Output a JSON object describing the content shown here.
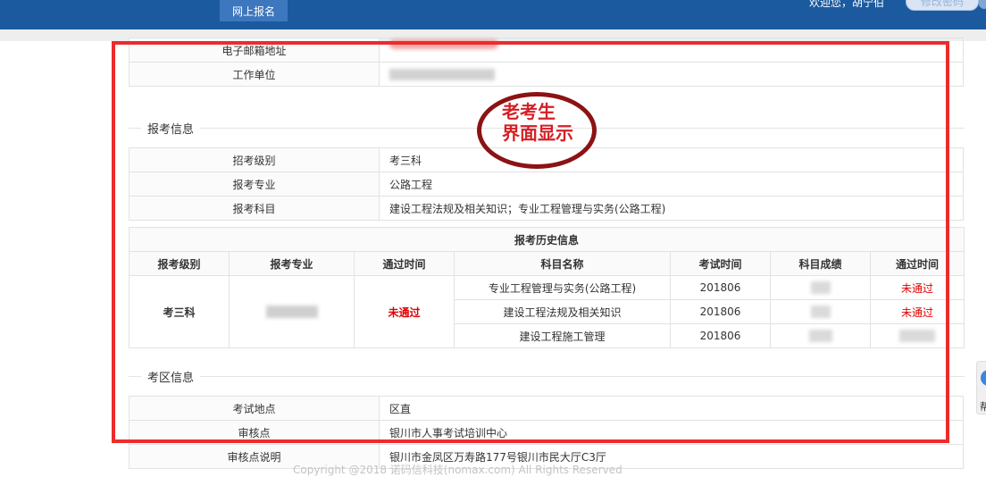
{
  "header": {
    "nav_tab": "网上报名",
    "welcome": "欢迎您，胡宁伯",
    "modify_button": "修改密码"
  },
  "personal_info": {
    "email_label": "电子邮箱地址",
    "workplace_label": "工作单位"
  },
  "exam_info": {
    "section_title": "报考信息",
    "rows": [
      {
        "label": "招考级别",
        "value": "考三科"
      },
      {
        "label": "报考专业",
        "value": "公路工程"
      },
      {
        "label": "报考科目",
        "value": "建设工程法规及相关知识；专业工程管理与实务(公路工程)"
      }
    ]
  },
  "history": {
    "title": "报考历史信息",
    "headers": [
      "报考级别",
      "报考专业",
      "通过时间",
      "科目名称",
      "考试时间",
      "科目成绩",
      "通过时间"
    ],
    "level": "考三科",
    "pass_time": "未通过",
    "rows": [
      {
        "subject": "专业工程管理与实务(公路工程)",
        "exam_time": "201806",
        "pass": "未通过"
      },
      {
        "subject": "建设工程法规及相关知识",
        "exam_time": "201806",
        "pass": "未通过"
      },
      {
        "subject": "建设工程施工管理",
        "exam_time": "201806",
        "pass": ""
      }
    ]
  },
  "exam_area": {
    "section_title": "考区信息",
    "rows": [
      {
        "label": "考试地点",
        "value": "区直"
      },
      {
        "label": "审核点",
        "value": "银川市人事考试培训中心"
      },
      {
        "label": "审核点说明",
        "value": "银川市金凤区万寿路177号银川市民大厅C3厅"
      }
    ]
  },
  "annotation": {
    "line1": "老考生",
    "line2": "界面显示"
  },
  "footer": "Copyright @2018 诺码信科技(nomax.com) All Rights Reserved",
  "side_widget": {
    "label": "帮"
  },
  "colors": {
    "header_bg": "#1c5aa0",
    "frame_red": "#ec2c2c",
    "fail_red": "#e00000",
    "annotation_ring": "#8c1214"
  }
}
